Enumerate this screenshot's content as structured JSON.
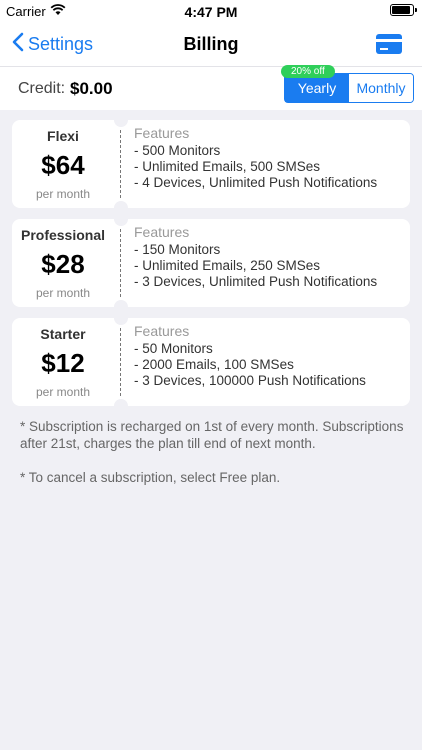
{
  "status": {
    "carrier": "Carrier",
    "time": "4:47 PM"
  },
  "nav": {
    "back_label": "Settings",
    "title": "Billing"
  },
  "credit": {
    "label": "Credit:",
    "value": "$0.00"
  },
  "billing_toggle": {
    "badge": "20% off",
    "options": [
      "Yearly",
      "Monthly"
    ],
    "selected": "Yearly"
  },
  "plans": [
    {
      "name": "Flexi",
      "price": "$64",
      "period": "per month",
      "features_title": "Features",
      "features": [
        "- 500 Monitors",
        "- Unlimited Emails, 500 SMSes",
        "- 4 Devices, Unlimited Push Notifications"
      ]
    },
    {
      "name": "Professional",
      "price": "$28",
      "period": "per month",
      "features_title": "Features",
      "features": [
        "- 150 Monitors",
        "- Unlimited Emails, 250 SMSes",
        "- 3 Devices, Unlimited Push Notifications"
      ]
    },
    {
      "name": "Starter",
      "price": "$12",
      "period": "per month",
      "features_title": "Features",
      "features": [
        "- 50 Monitors",
        "- 2000 Emails, 100 SMSes",
        "- 3 Devices, 100000 Push Notifications"
      ]
    }
  ],
  "notes": [
    "* Subscription is recharged on 1st of every month. Subscriptions after 21st, charges the plan till end of next month.",
    "* To cancel a subscription, select Free plan."
  ],
  "icons": {
    "wifi": "wifi-icon",
    "battery": "battery-icon",
    "back": "chevron-left-icon",
    "card": "credit-card-icon"
  },
  "colors": {
    "accent": "#1a7cf0",
    "badge": "#2fcf5a",
    "background": "#f0f0f5"
  }
}
